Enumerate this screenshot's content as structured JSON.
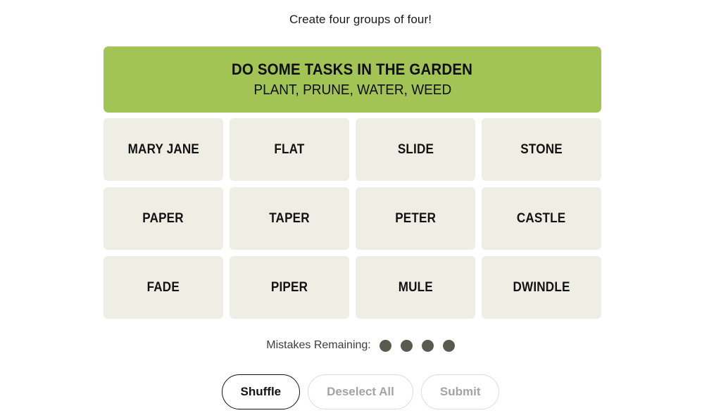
{
  "instruction": "Create four groups of four!",
  "solved_groups": [
    {
      "title": "DO SOME TASKS IN THE GARDEN",
      "members": "PLANT, PRUNE, WATER, WEED",
      "color": "#a2c455"
    }
  ],
  "grid": {
    "rows": [
      [
        "MARY JANE",
        "FLAT",
        "SLIDE",
        "STONE"
      ],
      [
        "PAPER",
        "TAPER",
        "PETER",
        "CASTLE"
      ],
      [
        "FADE",
        "PIPER",
        "MULE",
        "DWINDLE"
      ]
    ]
  },
  "mistakes": {
    "label": "Mistakes Remaining:",
    "remaining": 4,
    "dot_color": "#5a5a4e"
  },
  "controls": {
    "shuffle_label": "Shuffle",
    "deselect_label": "Deselect All",
    "submit_label": "Submit"
  },
  "tile_color": "#eeeee5"
}
